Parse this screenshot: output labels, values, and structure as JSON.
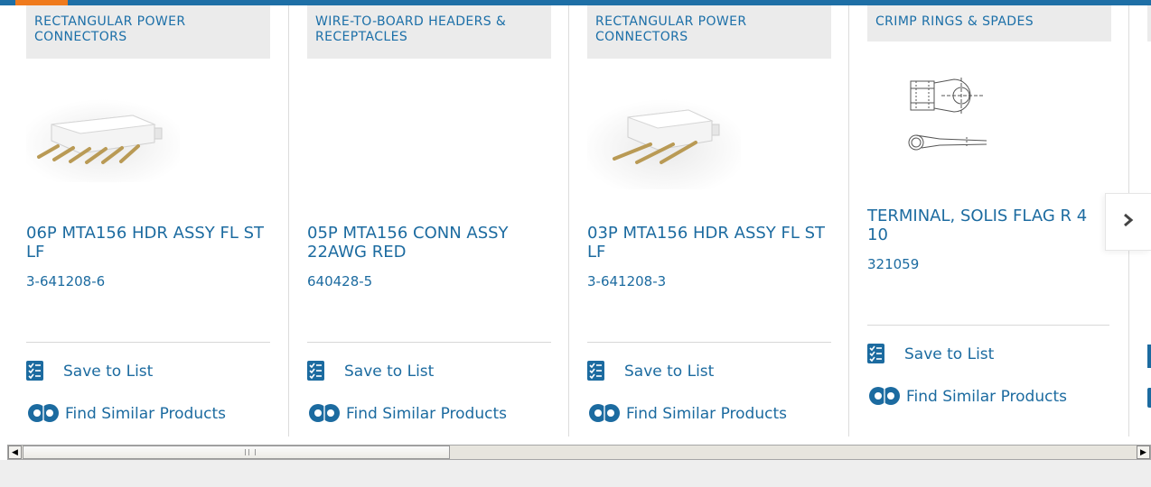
{
  "cards": [
    {
      "category": "RECTANGULAR POWER CONNECTORS",
      "title": "06P MTA156 HDR ASSY FL ST LF",
      "part_number": "3-641208-6",
      "image": "header-6pin-image"
    },
    {
      "category": "WIRE-TO-BOARD HEADERS & RECEPTACLES",
      "title": "05P MTA156 CONN ASSY 22AWG RED",
      "part_number": "640428-5",
      "image": ""
    },
    {
      "category": "RECTANGULAR POWER CONNECTORS",
      "title": "03P MTA156 HDR ASSY FL ST LF",
      "part_number": "3-641208-3",
      "image": "header-3pin-image"
    },
    {
      "category": "CRIMP RINGS & SPADES",
      "title": "TERMINAL, SOLIS FLAG R 4 10",
      "part_number": "321059",
      "image": "ring-terminal-drawing"
    }
  ],
  "actions": {
    "save_label": "Save to List",
    "similar_label": "Find Similar Products"
  },
  "colors": {
    "link": "#1c6ba0",
    "accent_bar": "#1e6fa6",
    "accent_orange": "#ef7a1d",
    "category_bg": "#ebebeb"
  },
  "icons": {
    "save": "checklist-icon",
    "similar": "similar-products-icon",
    "next": "chevron-right-icon"
  }
}
